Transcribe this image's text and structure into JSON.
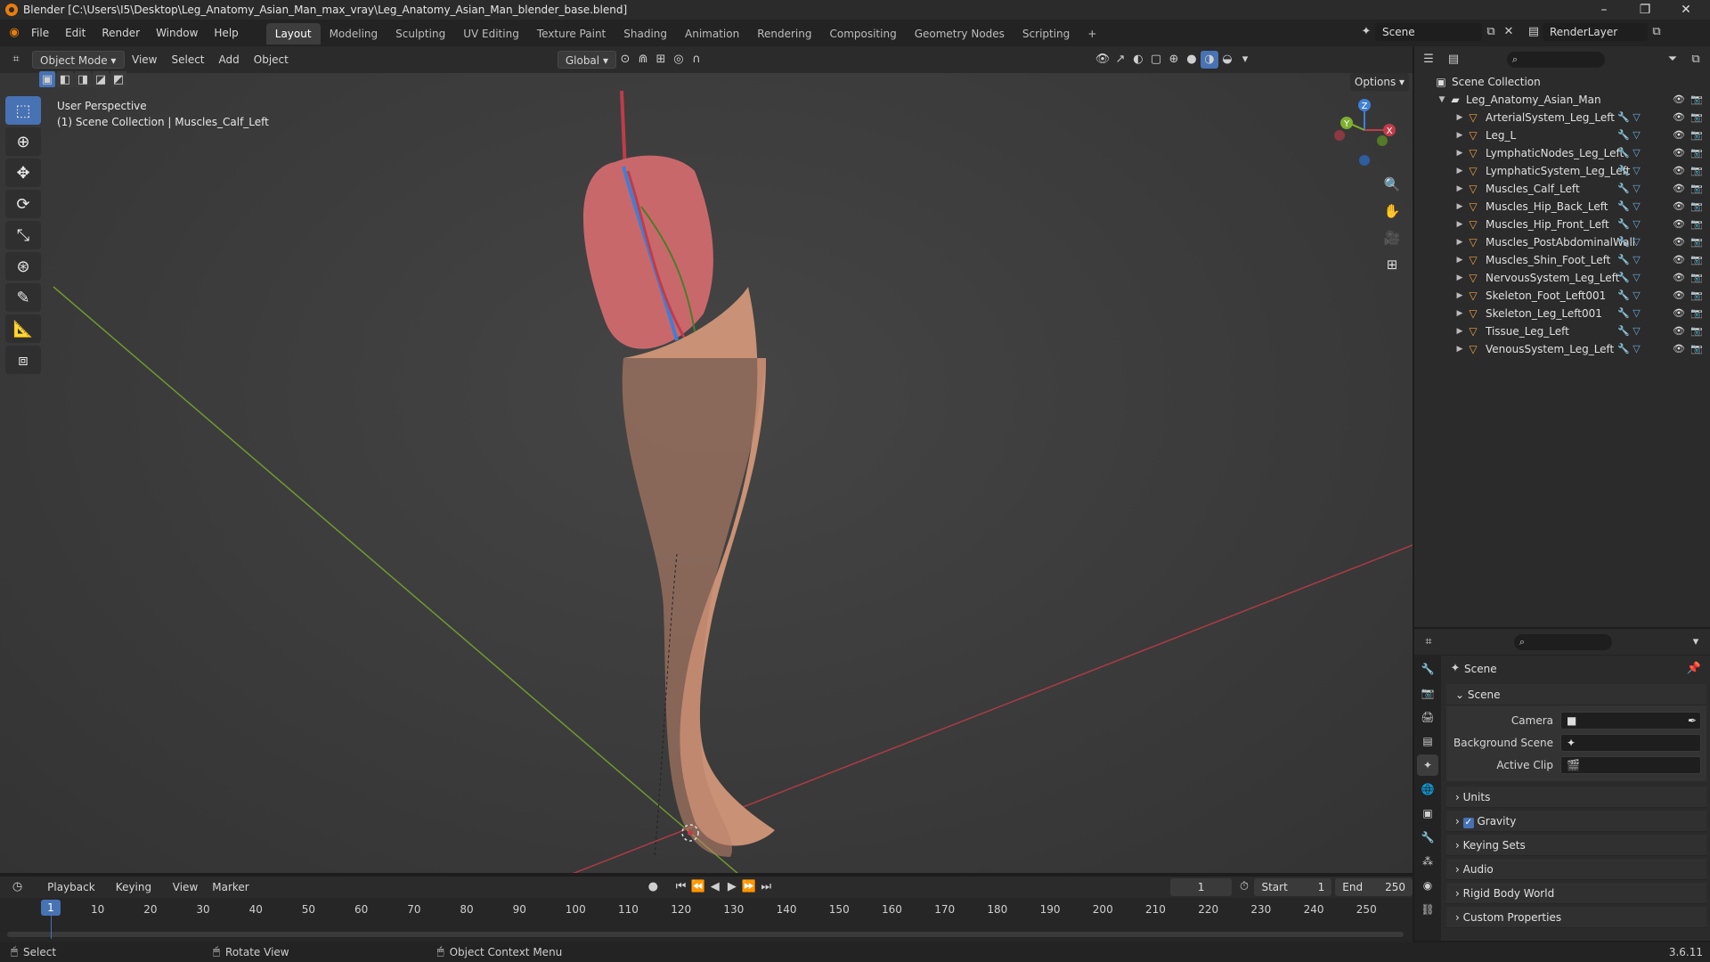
{
  "window": {
    "title": "Blender [C:\\Users\\I5\\Desktop\\Leg_Anatomy_Asian_Man_max_vray\\Leg_Anatomy_Asian_Man_blender_base.blend]",
    "minimize": "–",
    "maximize": "❐",
    "close": "✕"
  },
  "menu": [
    "File",
    "Edit",
    "Render",
    "Window",
    "Help"
  ],
  "workspaces": [
    "Layout",
    "Modeling",
    "Sculpting",
    "UV Editing",
    "Texture Paint",
    "Shading",
    "Animation",
    "Rendering",
    "Compositing",
    "Geometry Nodes",
    "Scripting",
    "+"
  ],
  "active_workspace": "Layout",
  "scene_selector": {
    "scene": "Scene",
    "view_layer": "RenderLayer"
  },
  "viewport_header": {
    "mode": "Object Mode",
    "menus": [
      "View",
      "Select",
      "Add",
      "Object"
    ],
    "transform_orientation": "Global",
    "options": "Options"
  },
  "viewport": {
    "perspective": "User Perspective",
    "collection_info": "(1) Scene Collection | Muscles_Calf_Left",
    "axes": {
      "x": "X",
      "y": "Y",
      "z": "Z"
    }
  },
  "outliner": {
    "root": "Scene Collection",
    "collection": "Leg_Anatomy_Asian_Man",
    "objects": [
      {
        "name": "ArterialSystem_Leg_Left"
      },
      {
        "name": "Leg_L"
      },
      {
        "name": "LymphaticNodes_Leg_Left"
      },
      {
        "name": "LymphaticSystem_Leg_Left"
      },
      {
        "name": "Muscles_Calf_Left"
      },
      {
        "name": "Muscles_Hip_Back_Left"
      },
      {
        "name": "Muscles_Hip_Front_Left"
      },
      {
        "name": "Muscles_PostAbdominalWall"
      },
      {
        "name": "Muscles_Shin_Foot_Left"
      },
      {
        "name": "NervousSystem_Leg_Left"
      },
      {
        "name": "Skeleton_Foot_Left001"
      },
      {
        "name": "Skeleton_Leg_Left001"
      },
      {
        "name": "Tissue_Leg_Left"
      },
      {
        "name": "VenousSystem_Leg_Left"
      }
    ]
  },
  "properties": {
    "context": "Scene",
    "panel": "Scene",
    "camera_label": "Camera",
    "background_scene_label": "Background Scene",
    "active_clip_label": "Active Clip",
    "subpanels": [
      "Units",
      "Gravity",
      "Keying Sets",
      "Audio",
      "Rigid Body World",
      "Custom Properties"
    ]
  },
  "timeline": {
    "menus": [
      "Playback",
      "Keying",
      "View",
      "Marker"
    ],
    "current_frame": "1",
    "start_label": "Start",
    "start": "1",
    "end_label": "End",
    "end": "250",
    "ticks": [
      "10",
      "20",
      "30",
      "40",
      "50",
      "60",
      "70",
      "80",
      "90",
      "100",
      "110",
      "120",
      "130",
      "140",
      "150",
      "160",
      "170",
      "180",
      "190",
      "200",
      "210",
      "220",
      "230",
      "240",
      "250"
    ],
    "playhead": "1"
  },
  "statusbar": {
    "select": "Select",
    "rotate": "Rotate View",
    "context_menu": "Object Context Menu",
    "version": "3.6.11"
  },
  "colors": {
    "accent": "#4772b3",
    "object_orange": "#e8a045",
    "x_axis": "#c03c4a",
    "y_axis": "#7db02f",
    "z_axis": "#3f7fd6"
  }
}
